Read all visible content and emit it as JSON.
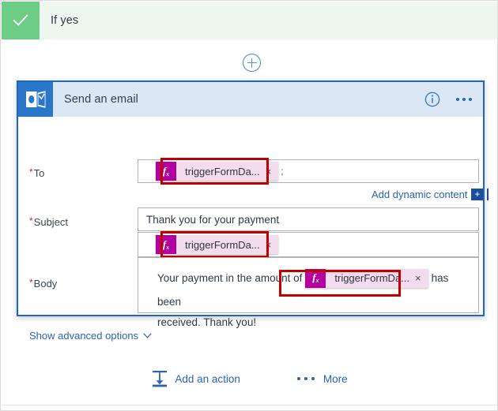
{
  "condition_branch": {
    "label": "If yes",
    "icon": "check-icon",
    "accent_color": "#6dcc85",
    "background_color": "#eef8ef"
  },
  "insert_button": {
    "icon": "plus-circle-icon",
    "color": "#4a84d0"
  },
  "card": {
    "icon": "outlook-icon",
    "title": "Send an email",
    "header_color": "#dce7f5",
    "border_color": "#2166ba",
    "info_icon": "info-icon",
    "more_icon": "ellipsis-icon",
    "fields": {
      "to": {
        "label": "To",
        "required_marker": "*",
        "token": {
          "fx": "fx",
          "text": "triggerFormDa...",
          "close": "×",
          "badge_color": "#b4009e",
          "body_color": "#f4dcef"
        },
        "trailing_text": ";"
      },
      "dynamic_content": {
        "label": "Add dynamic content",
        "button_glyph": "+"
      },
      "subject": {
        "label": "Subject",
        "required_marker": "*",
        "value": "Thank you for your payment",
        "token": {
          "fx": "fx",
          "text": "triggerFormDa...",
          "close": "×"
        }
      },
      "body": {
        "label": "Body",
        "required_marker": "*",
        "text_before": "Your payment in the amount of",
        "token": {
          "fx": "fx",
          "text": "triggerFormDa...",
          "close": "×"
        },
        "text_after": "has been",
        "text_line2": "received.  Thank you!"
      },
      "advanced": {
        "label": "Show advanced options",
        "icon": "chevron-down-icon"
      }
    }
  },
  "bottom_bar": {
    "add_action": {
      "label": "Add an action",
      "icon": "insert-below-icon"
    },
    "more": {
      "label": "More",
      "icon": "ellipsis-icon"
    }
  },
  "highlight_color": "#c00000"
}
